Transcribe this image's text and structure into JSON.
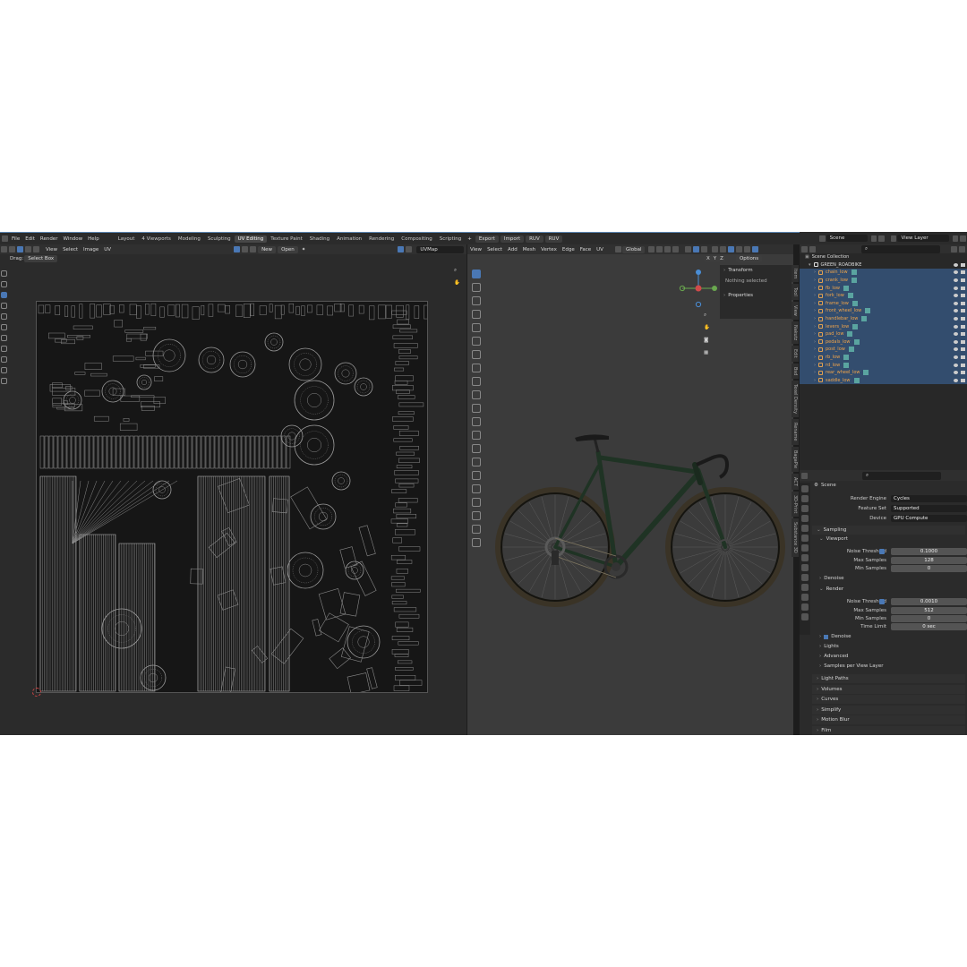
{
  "topbar": {
    "menus": [
      "File",
      "Edit",
      "Render",
      "Window",
      "Help"
    ],
    "workspaces": [
      "Layout",
      "4 Viewports",
      "Modeling",
      "Sculpting",
      "UV Editing",
      "Texture Paint",
      "Shading",
      "Animation",
      "Rendering",
      "Compositing",
      "Scripting"
    ],
    "active_workspace": "UV Editing",
    "addon_buttons": [
      "Export",
      "Import",
      "RUV",
      "RUV"
    ],
    "scene_label": "Scene",
    "view_layer_label": "View Layer"
  },
  "uv_editor": {
    "menus": [
      "View",
      "Select",
      "Image",
      "UV"
    ],
    "new_label": "New",
    "open_label": "Open",
    "uvmap_label": "UVMap",
    "drag_label": "Drag:",
    "select_box_label": "Select Box"
  },
  "viewport": {
    "menus": [
      "View",
      "Select",
      "Add",
      "Mesh",
      "Vertex",
      "Edge",
      "Face",
      "UV"
    ],
    "orientation_label": "Global",
    "options_label": "Options",
    "axes": [
      "X",
      "Y",
      "Z"
    ],
    "npanel": {
      "transform_label": "Transform",
      "nothing_selected": "Nothing selected",
      "properties_label": "Properties"
    },
    "side_tabs": [
      "Item",
      "Tool",
      "View",
      "Nakutz",
      "Edit",
      "Bsd",
      "Texel Density",
      "Rename",
      "BagaPie",
      "ACT",
      "3D-Print",
      "Substance 3D"
    ]
  },
  "outliner": {
    "root": "Scene Collection",
    "collection": "GREEN_ROADBIKE",
    "objects": [
      "chain_low",
      "crank_low",
      "fb_low",
      "fork_low",
      "frame_low",
      "front_wheel_low",
      "handlebar_low",
      "levers_low",
      "pad_low",
      "pedals_low",
      "post_low",
      "rb_low",
      "rd_low",
      "rear_wheel_low",
      "saddle_low"
    ]
  },
  "properties": {
    "scene_label": "Scene",
    "render_engine": {
      "label": "Render Engine",
      "value": "Cycles"
    },
    "feature_set": {
      "label": "Feature Set",
      "value": "Supported"
    },
    "device": {
      "label": "Device",
      "value": "GPU Compute"
    },
    "sampling_label": "Sampling",
    "viewport_label": "Viewport",
    "viewport_noise_threshold": {
      "label": "Noise Threshold",
      "value": "0.1000"
    },
    "viewport_max_samples": {
      "label": "Max Samples",
      "value": "128"
    },
    "viewport_min_samples": {
      "label": "Min Samples",
      "value": "0"
    },
    "denoise_label": "Denoise",
    "render_label": "Render",
    "render_noise_threshold": {
      "label": "Noise Threshold",
      "value": "0.0010"
    },
    "render_max_samples": {
      "label": "Max Samples",
      "value": "512"
    },
    "render_min_samples": {
      "label": "Min Samples",
      "value": "0"
    },
    "time_limit": {
      "label": "Time Limit",
      "value": "0 sec"
    },
    "render_denoise_label": "Denoise",
    "subsections": [
      "Lights",
      "Advanced",
      "Samples per View Layer"
    ],
    "panels": [
      "Light Paths",
      "Volumes",
      "Curves",
      "Simplify",
      "Motion Blur",
      "Film"
    ]
  },
  "colors": {
    "accent": "#4a78b5",
    "object_name": "#f0a44a",
    "selection": "#334d6e",
    "bike_frame": "#1f3324"
  }
}
